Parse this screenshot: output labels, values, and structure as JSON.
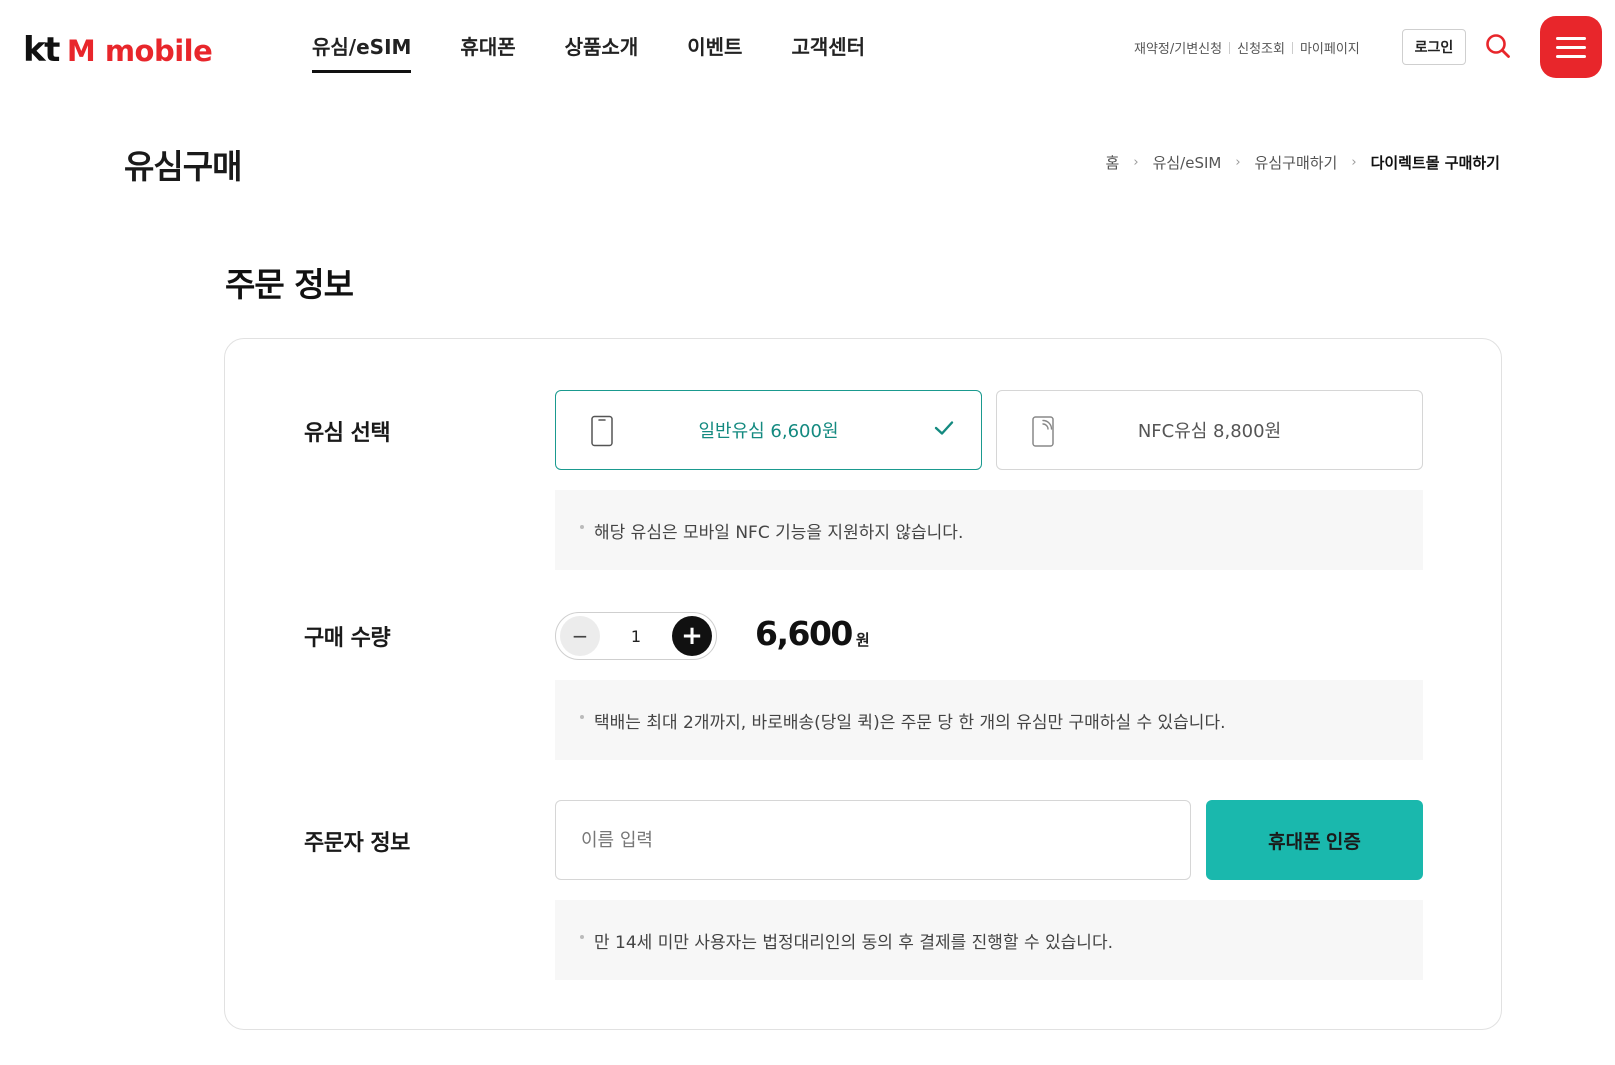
{
  "header": {
    "logo_kt": "kt",
    "logo_brand": "M mobile",
    "nav": [
      {
        "label": "유심/eSIM",
        "active": true
      },
      {
        "label": "휴대폰",
        "active": false
      },
      {
        "label": "상품소개",
        "active": false
      },
      {
        "label": "이벤트",
        "active": false
      },
      {
        "label": "고객센터",
        "active": false
      }
    ],
    "util_links": [
      "재약정/기변신청",
      "신청조회",
      "마이페이지"
    ],
    "login_label": "로그인",
    "search_icon": "search-icon",
    "menu_icon": "hamburger-menu-icon",
    "brand_color": "#e8262b"
  },
  "page": {
    "title": "유심구매",
    "breadcrumb": [
      "홈",
      "유심/eSIM",
      "유심구매하기",
      "다이렉트몰 구매하기"
    ]
  },
  "order": {
    "section_title": "주문 정보",
    "sim": {
      "label": "유심 선택",
      "options": [
        {
          "label": "일반유심 6,600원",
          "selected": true,
          "icon": "phone-icon"
        },
        {
          "label": "NFC유심 8,800원",
          "selected": false,
          "icon": "nfc-phone-icon"
        }
      ],
      "note": "해당 유심은 모바일 NFC 기능을 지원하지 않습니다.",
      "accent_color": "#1a9a8f"
    },
    "quantity": {
      "label": "구매 수량",
      "value": "1",
      "price": "6,600",
      "unit": "원",
      "note": "택배는 최대 2개까지, 바로배송(당일 퀵)은 주문 당 한 개의 유심만 구매하실 수 있습니다."
    },
    "orderer": {
      "label": "주문자 정보",
      "name_placeholder": "이름 입력",
      "name_value": "",
      "auth_button": "휴대폰 인증",
      "auth_color": "#1ab8ad",
      "note": "만 14세 미만 사용자는 법정대리인의 동의 후 결제를 진행할 수 있습니다."
    }
  }
}
